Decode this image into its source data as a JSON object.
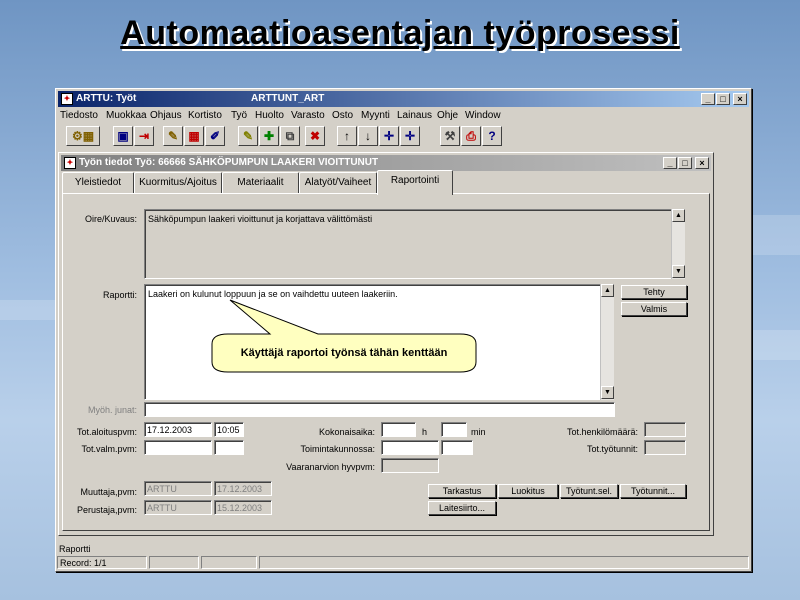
{
  "slide": {
    "title": "Automaatioasentajan työprosessi"
  },
  "main_window": {
    "title_left": "ARTTU: Työt",
    "title_center": "ARTTUNT_ART",
    "controls": [
      "_",
      "□",
      "×"
    ]
  },
  "menu": [
    "Tiedosto",
    "Muokkaa",
    "Ohjaus",
    "Kortisto",
    "Työ",
    "Huolto",
    "Varasto",
    "Osto",
    "Myynti",
    "Lainaus",
    "Ohje",
    "Window"
  ],
  "toolbar": {
    "icons": [
      "wizard-icon",
      "save-icon",
      "exit-icon",
      "edit-icon",
      "grid-icon",
      "pen-icon",
      "add-icon",
      "copy-icon",
      "delete-icon",
      "arrow-up-icon",
      "arrow-down-icon",
      "add-up-icon",
      "add-down-icon",
      "tools-icon",
      "print-icon",
      "help-icon"
    ]
  },
  "child_window": {
    "title": "Työn tiedot  Työ: 66666 SÄHKÖPUMPUN LAAKERI VIOITTUNUT",
    "controls": [
      "_",
      "□",
      "×"
    ]
  },
  "tabs": [
    {
      "label": "Yleistiedot",
      "active": false
    },
    {
      "label": "Kuormitus/Ajoitus",
      "active": false
    },
    {
      "label": "Materiaalit",
      "active": false
    },
    {
      "label": "Alatyöt/Vaiheet",
      "active": false
    },
    {
      "label": "Raportointi",
      "active": true
    }
  ],
  "form": {
    "oire_label": "Oire/Kuvaus:",
    "oire_text": "Sähköpumpun laakeri vioittunut ja korjattava välittömästi",
    "raportti_label": "Raportti:",
    "raportti_text": "Laakeri on kulunut loppuun ja se on vaihdettu uuteen laakeriin.",
    "myoh_label": "Myöh. junat:",
    "aloitus_label": "Tot.aloituspvm:",
    "aloitus_date": "17.12.2003",
    "aloitus_time": "10:05",
    "valm_label": "Tot.valm.pvm:",
    "kokonais_label": "Kokonaisaika:",
    "h_unit": "h",
    "min_unit": "min",
    "toiminta_label": "Toimintakunnossa:",
    "vaara_label": "Vaaranarvion hyvpvm:",
    "henkilo_label": "Tot.henkilömäärä:",
    "tyotunnit_label": "Tot.työtunnit:",
    "muuttaja_label": "Muuttaja,pvm:",
    "muuttaja_user": "ARTTU",
    "muuttaja_date": "17.12.2003",
    "perustaja_label": "Perustaja,pvm:",
    "perustaja_user": "ARTTU",
    "perustaja_date": "15.12.2003"
  },
  "buttons": {
    "tehty": "Tehty",
    "valmis": "Valmis",
    "tarkastus": "Tarkastus",
    "luokitus": "Luokitus",
    "tyotunt_sel": "Työtunt.sel.",
    "tyotunnit": "Työtunnit...",
    "laitesiirto": "Laitesiirto..."
  },
  "callout": {
    "text": "Käyttäjä raportoi työnsä tähän kenttään"
  },
  "statusbar": {
    "line1": "Raportti",
    "line2": "Record: 1/1"
  },
  "colors": {
    "accent_title": "#0a246a",
    "callout_fill": "#ffffc0",
    "window_face": "#d4d0c8"
  }
}
